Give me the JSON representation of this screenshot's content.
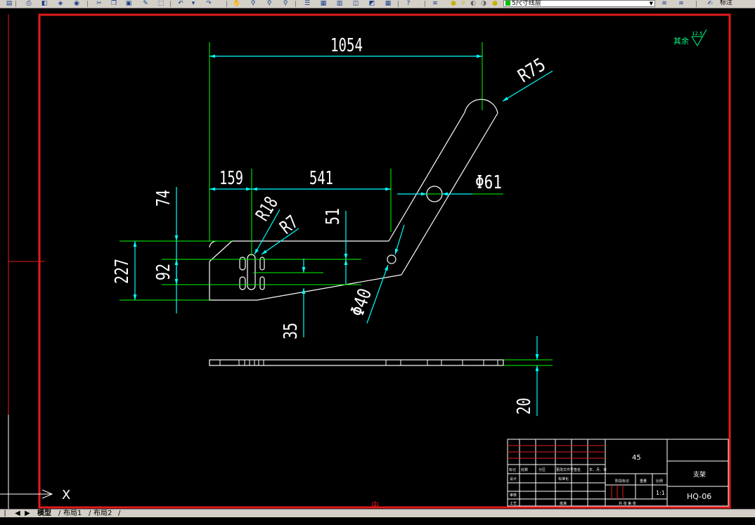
{
  "toolbar": {
    "layer_name": "5尺寸线层",
    "style_label": "标注",
    "icons": [
      "save-icon",
      "print-icon",
      "preview-icon",
      "publish-icon",
      "cut-icon",
      "copy-icon",
      "paste-icon",
      "matchprop-icon",
      "undo-icon",
      "redo-icon",
      "pan-icon",
      "zoom-realtime-icon",
      "zoom-window-icon",
      "zoom-previous-icon",
      "properties-icon",
      "designcenter-icon",
      "toolpalette-icon",
      "markup-icon",
      "calculator-icon",
      "help-icon",
      "layer-manager-icon"
    ]
  },
  "drawing": {
    "dims": {
      "d1054": "1054",
      "r75": "R75",
      "d159": "159",
      "d541": "541",
      "phi61": "Φ61",
      "d74": "74",
      "r18": "R18",
      "r7": "R7",
      "d51": "51",
      "d227": "227",
      "d92": "92",
      "phi40": "Φ40",
      "d35": "35",
      "d20": "20"
    },
    "roughness_prefix": "其余",
    "roughness_value": "12.5",
    "ucs_x": "X",
    "center_mark": "中"
  },
  "title_block": {
    "material": "45",
    "part_name": "支架",
    "drawing_number": "HQ-06",
    "scale": "1:1",
    "row_labels": [
      "标记",
      "处数",
      "分区",
      "更改文件号",
      "签名",
      "年、月、日"
    ],
    "design": "设计",
    "standard": "标准化",
    "review": "审核",
    "process": "工艺",
    "approve": "批准",
    "stage_mark": "阶段标记",
    "weight": "重量",
    "ratio": "比例",
    "sheets": "共  张  第  张"
  },
  "tabs": {
    "model": "模型",
    "layout1": "布局1",
    "layout2": "布局2"
  },
  "colors": {
    "background": "#000000",
    "border": "#ff0000",
    "geometry": "#ffffff",
    "dimension": "#00ffff",
    "extension": "#00ff00",
    "title_grid": "#ff0000"
  }
}
